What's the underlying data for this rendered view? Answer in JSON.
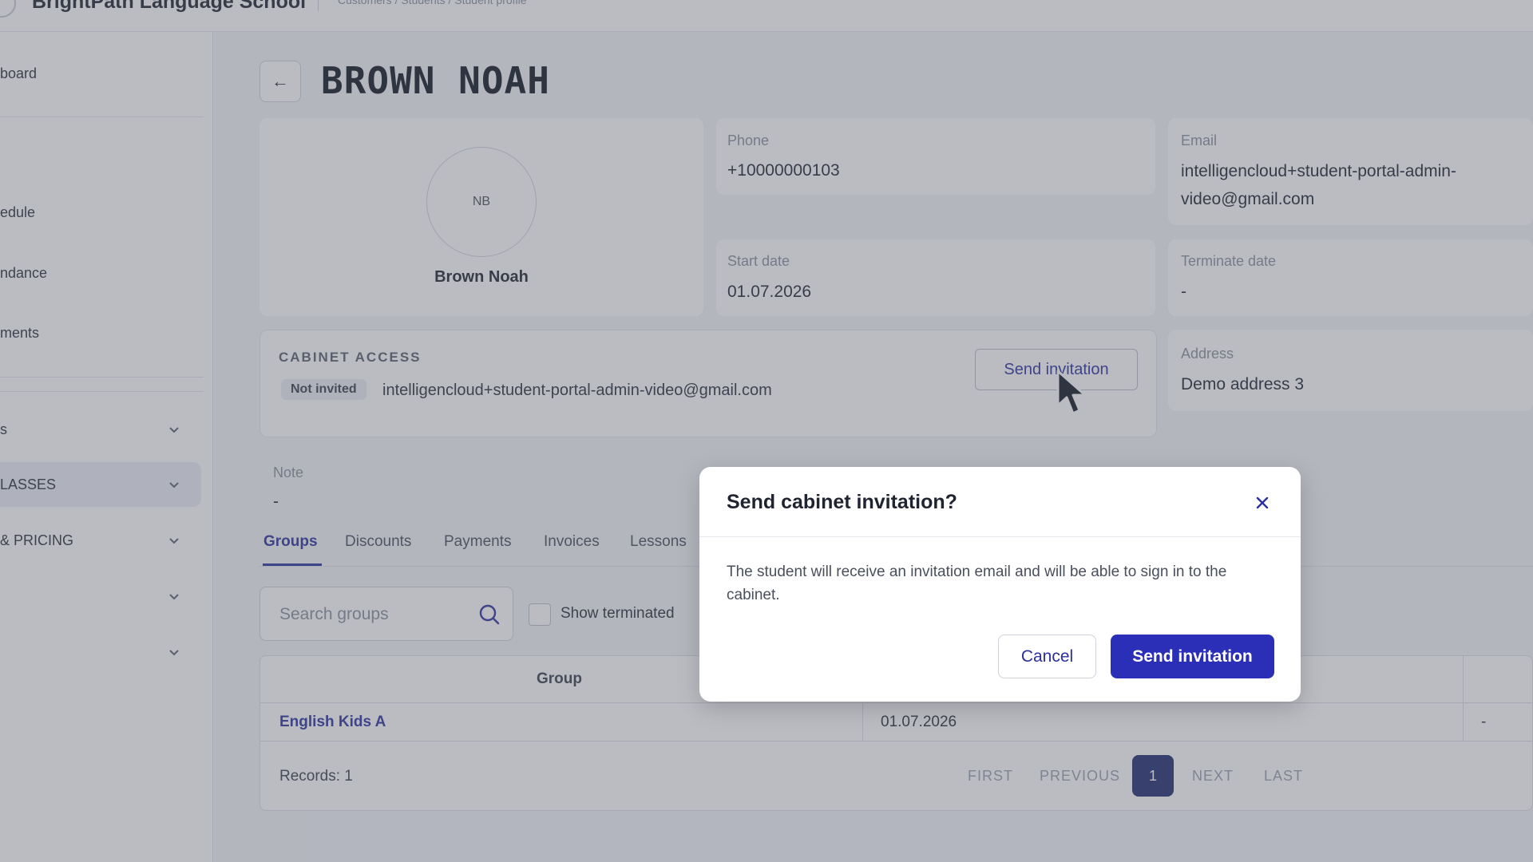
{
  "topbar": {
    "brand": "BrightPath Language School",
    "breadcrumb": "Customers / Students / Student profile"
  },
  "sidebar": {
    "items": [
      {
        "label": "board"
      },
      {
        "label": "edule"
      },
      {
        "label": "ndance"
      },
      {
        "label": "ments"
      }
    ],
    "groups": [
      {
        "label": "s"
      },
      {
        "label": "LASSES"
      },
      {
        "label": "& PRICING"
      },
      {
        "label": ""
      },
      {
        "label": ""
      }
    ]
  },
  "page": {
    "back_glyph": "←",
    "title": "BROWN NOAH"
  },
  "profile": {
    "initials": "NB",
    "name": "Brown Noah",
    "phone_label": "Phone",
    "phone": "+10000000103",
    "email_label": "Email",
    "email": "intelligencloud+student-portal-admin-video@gmail.com",
    "start_label": "Start date",
    "start": "01.07.2026",
    "terminate_label": "Terminate date",
    "terminate": "-",
    "address_label": "Address",
    "address": "Demo address 3",
    "note_label": "Note",
    "note": "-"
  },
  "cabinet": {
    "title": "CABINET ACCESS",
    "status": "Not invited",
    "email": "intelligencloud+student-portal-admin-video@gmail.com",
    "send_label": "Send invitation"
  },
  "tabs": [
    {
      "label": "Groups",
      "active": true
    },
    {
      "label": "Discounts"
    },
    {
      "label": "Payments"
    },
    {
      "label": "Invoices"
    },
    {
      "label": "Lessons"
    }
  ],
  "groups": {
    "search_placeholder": "Search groups",
    "show_terminated": "Show terminated",
    "columns": [
      "Group"
    ],
    "rows": [
      {
        "group": "English Kids A",
        "start": "01.07.2026",
        "end": "-"
      }
    ],
    "records": "Records: 1",
    "pagination": {
      "first": "FIRST",
      "previous": "PREVIOUS",
      "page": "1",
      "next": "NEXT",
      "last": "LAST"
    }
  },
  "modal": {
    "title": "Send cabinet invitation?",
    "body": "The student will receive an invitation email and will be able to sign in to the cabinet.",
    "cancel": "Cancel",
    "confirm": "Send invitation"
  },
  "colors": {
    "accent": "#2b2fb8",
    "link": "#2b2f9c",
    "page_active": "#1f2a6e"
  }
}
